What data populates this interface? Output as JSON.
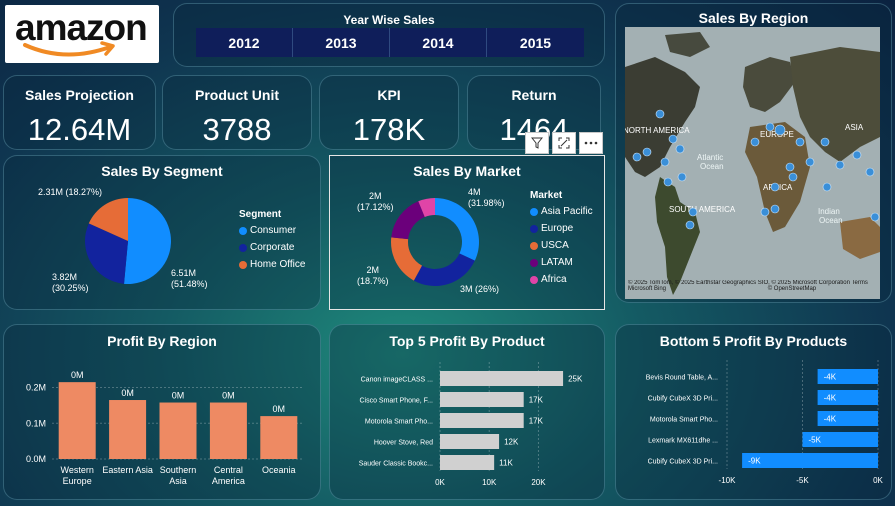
{
  "logo": {
    "text": "amazon"
  },
  "year_slicer": {
    "title": "Year Wise Sales",
    "years": [
      "2012",
      "2013",
      "2014",
      "2015"
    ]
  },
  "kpis": [
    {
      "title": "Sales Projection",
      "value": "12.64M"
    },
    {
      "title": "Product Unit",
      "value": "3788"
    },
    {
      "title": "KPI",
      "value": "178K"
    },
    {
      "title": "Return",
      "value": "1464"
    }
  ],
  "visual_header": {
    "icons": [
      "filter-icon",
      "focus-mode-icon",
      "more-options-icon"
    ]
  },
  "sales_by_segment": {
    "title": "Sales By Segment",
    "legend_title": "Segment",
    "chart_data": {
      "type": "pie",
      "categories": [
        "Consumer",
        "Corporate",
        "Home Office"
      ],
      "values": [
        51.48,
        30.25,
        18.27
      ],
      "labels": [
        "6.51M\n(51.48%)",
        "3.82M\n(30.25%)",
        "2.31M (18.27%)"
      ],
      "colors": [
        "#118dff",
        "#12239e",
        "#e66c37"
      ]
    }
  },
  "sales_by_market": {
    "title": "Sales By Market",
    "legend_title": "Market",
    "chart_data": {
      "type": "pie",
      "donut": true,
      "categories": [
        "Asia Pacific",
        "Europe",
        "USCA",
        "LATAM",
        "Africa"
      ],
      "values": [
        31.98,
        26,
        18.7,
        17.12,
        6.2
      ],
      "labels": [
        "4M\n(31.98%)",
        "3M (26%)",
        "2M\n(18.7%)",
        "2M\n(17.12%)",
        ""
      ],
      "colors": [
        "#118dff",
        "#12239e",
        "#e66c37",
        "#6b007b",
        "#e044a7"
      ]
    }
  },
  "sales_by_region": {
    "title": "Sales By Region",
    "labels": [
      "NORTH AMERICA",
      "EUROPE",
      "ASIA",
      "Atlantic",
      "Ocean",
      "AFRICA",
      "SOUTH AMERICA",
      "Indian",
      "Ocean"
    ],
    "attribution": "© 2025 TomTom, © 2025 Earthstar Geographics SIO, © 2025 Microsoft Corporation  Terms",
    "attribution2": "Microsoft Bing",
    "attribution3": "© OpenStreetMap"
  },
  "profit_by_region": {
    "title": "Profit By Region",
    "chart_data": {
      "type": "bar",
      "categories": [
        "Western\nEurope",
        "Eastern Asia",
        "Southern\nAsia",
        "Central\nAmerica",
        "Oceania"
      ],
      "values": [
        0.215,
        0.165,
        0.158,
        0.158,
        0.12
      ],
      "data_labels": [
        "0M",
        "0M",
        "0M",
        "0M",
        "0M"
      ],
      "y_ticks": [
        0,
        0.1,
        0.2
      ],
      "y_tick_labels": [
        "0.0M",
        "0.1M",
        "0.2M"
      ],
      "ylim": [
        0,
        0.235
      ],
      "color": "#ee8a63"
    }
  },
  "top5_profit": {
    "title": "Top 5 Profit By Product",
    "chart_data": {
      "type": "bar",
      "orientation": "horizontal",
      "categories": [
        "Canon imageCLASS ...",
        "Cisco Smart Phone, F...",
        "Motorola Smart Pho...",
        "Hoover Stove, Red",
        "Sauder Classic Bookc..."
      ],
      "values": [
        25,
        17,
        17,
        12,
        11
      ],
      "data_labels": [
        "25K",
        "17K",
        "17K",
        "12K",
        "11K"
      ],
      "x_ticks": [
        0,
        10,
        20
      ],
      "x_tick_labels": [
        "0K",
        "10K",
        "20K"
      ],
      "xlim": [
        0,
        26
      ],
      "color": "#d0d0d0"
    }
  },
  "bottom5_profit": {
    "title": "Bottom 5 Profit By Products",
    "chart_data": {
      "type": "bar",
      "orientation": "horizontal",
      "categories": [
        "Bevis Round Table, A...",
        "Cubify CubeX 3D Pri...",
        "Motorola Smart Pho...",
        "Lexmark MX611dhe ...",
        "Cubify CubeX 3D Pri..."
      ],
      "values": [
        -4,
        -4,
        -4,
        -5,
        -9
      ],
      "data_labels": [
        "-4K",
        "-4K",
        "-4K",
        "-5K",
        "-9K"
      ],
      "x_ticks": [
        -10,
        -5,
        0
      ],
      "x_tick_labels": [
        "-10K",
        "-5K",
        "0K"
      ],
      "xlim": [
        -10,
        0
      ],
      "color": "#118dff"
    }
  }
}
